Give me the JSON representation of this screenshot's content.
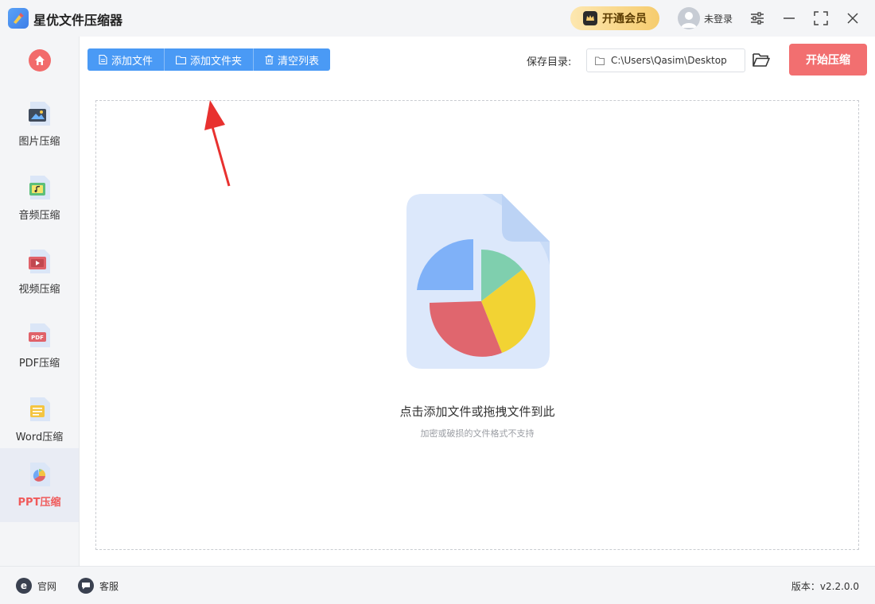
{
  "app": {
    "title": "星优文件压缩器"
  },
  "header": {
    "vip_label": "开通会员",
    "user_label": "未登录"
  },
  "sidebar": {
    "items": [
      {
        "label": "图片压缩",
        "icon": "image-file-icon"
      },
      {
        "label": "音频压缩",
        "icon": "audio-file-icon"
      },
      {
        "label": "视频压缩",
        "icon": "video-file-icon"
      },
      {
        "label": "PDF压缩",
        "icon": "pdf-file-icon"
      },
      {
        "label": "Word压缩",
        "icon": "word-file-icon"
      },
      {
        "label": "PPT压缩",
        "icon": "ppt-file-icon",
        "active": true
      }
    ],
    "pdf_badge": "PDF"
  },
  "toolbar": {
    "add_file": "添加文件",
    "add_folder": "添加文件夹",
    "clear_list": "清空列表",
    "save_dir_label": "保存目录:",
    "save_path": "C:\\Users\\Qasim\\Desktop",
    "start_label": "开始压缩"
  },
  "dropzone": {
    "main_text": "点击添加文件或拖拽文件到此",
    "sub_text": "加密或破损的文件格式不支持"
  },
  "footer": {
    "website": "官网",
    "service": "客服",
    "website_icon_glyph": "e",
    "version": "版本：v2.2.0.0"
  },
  "colors": {
    "accent_blue": "#4a9af5",
    "accent_red": "#f26f70",
    "active_text": "#f05a5a",
    "vip_gold": "#f6cc6e"
  }
}
